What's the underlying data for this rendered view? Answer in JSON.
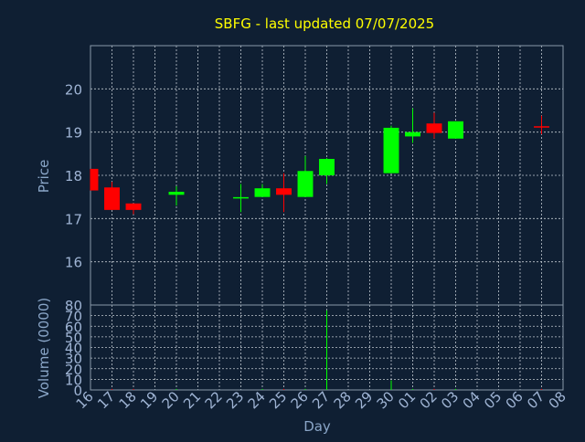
{
  "chart_data": {
    "type": "candlestick",
    "title": "SBFG - last updated 07/07/2025",
    "xlabel": "Day",
    "price_panel": {
      "ylabel": "Price",
      "ylim": [
        15,
        21
      ],
      "yticks": [
        16,
        17,
        18,
        19,
        20
      ],
      "grid": true
    },
    "volume_panel": {
      "ylabel": "Volume (0000)",
      "ylim": [
        0,
        80
      ],
      "yticks": [
        0,
        10,
        20,
        30,
        40,
        50,
        60,
        70,
        80
      ],
      "grid": true
    },
    "x_ticks": [
      "16",
      "17",
      "18",
      "19",
      "20",
      "21",
      "22",
      "23",
      "24",
      "25",
      "26",
      "27",
      "28",
      "29",
      "30",
      "01",
      "02",
      "03",
      "04",
      "05",
      "06",
      "07",
      "08"
    ],
    "candles": [
      {
        "day": "16",
        "open": 18.15,
        "high": 18.15,
        "low": 17.65,
        "close": 17.65
      },
      {
        "day": "17",
        "open": 17.72,
        "high": 17.85,
        "low": 17.2,
        "close": 17.2
      },
      {
        "day": "18",
        "open": 17.35,
        "high": 17.35,
        "low": 17.1,
        "close": 17.2
      },
      {
        "day": "20",
        "open": 17.55,
        "high": 17.75,
        "low": 17.3,
        "close": 17.62
      },
      {
        "day": "23",
        "open": 17.45,
        "high": 17.8,
        "low": 17.15,
        "close": 17.48
      },
      {
        "day": "24",
        "open": 17.5,
        "high": 17.8,
        "low": 17.5,
        "close": 17.7
      },
      {
        "day": "25",
        "open": 17.7,
        "high": 18.05,
        "low": 17.15,
        "close": 17.55
      },
      {
        "day": "26",
        "open": 17.5,
        "high": 18.45,
        "low": 17.5,
        "close": 18.1
      },
      {
        "day": "27",
        "open": 18.0,
        "high": 18.4,
        "low": 17.8,
        "close": 18.38
      },
      {
        "day": "30",
        "open": 18.05,
        "high": 19.15,
        "low": 18.05,
        "close": 19.1
      },
      {
        "day": "01",
        "open": 18.9,
        "high": 19.55,
        "low": 18.75,
        "close": 19.0
      },
      {
        "day": "02",
        "open": 19.2,
        "high": 19.45,
        "low": 18.85,
        "close": 18.98
      },
      {
        "day": "03",
        "open": 18.85,
        "high": 19.25,
        "low": 18.85,
        "close": 19.25
      },
      {
        "day": "07",
        "open": 19.12,
        "high": 19.38,
        "low": 18.95,
        "close": 19.1
      }
    ],
    "volume": [
      {
        "day": "17",
        "value": 1
      },
      {
        "day": "18",
        "value": 1
      },
      {
        "day": "20",
        "value": 1
      },
      {
        "day": "24",
        "value": 1
      },
      {
        "day": "25",
        "value": 1
      },
      {
        "day": "26",
        "value": 1
      },
      {
        "day": "27",
        "value": 75
      },
      {
        "day": "30",
        "value": 9
      },
      {
        "day": "01",
        "value": 1
      },
      {
        "day": "02",
        "value": 1
      },
      {
        "day": "03",
        "value": 1
      },
      {
        "day": "07",
        "value": 1
      }
    ],
    "colors": {
      "background": "#0f1f33",
      "frame": "#8899aa",
      "grid": "#c0c8d0",
      "up": "#00ff00",
      "down": "#ff0000",
      "title": "#ffff00",
      "label": "#8aa6c8",
      "tick_label": "#9fb4d4"
    }
  }
}
